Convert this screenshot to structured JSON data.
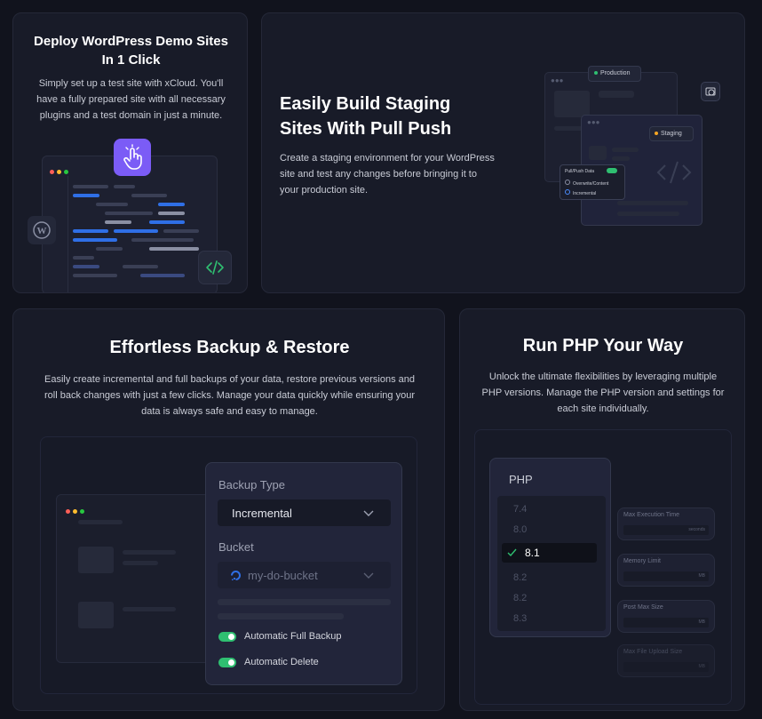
{
  "deploy": {
    "title_line1": "Deploy WordPress Demo Sites",
    "title_line2": "In 1 Click",
    "desc_line1": "Simply set up a test site with xCloud. You'll",
    "desc_line2": "have a fully prepared site with all necessary",
    "desc_line3": "plugins and a test domain in just a minute."
  },
  "staging": {
    "title_line1": "Easily Build Staging",
    "title_line2": "Sites With Pull Push",
    "desc_line1": "Create a staging environment for your WordPress",
    "desc_line2": "site and test any changes before bringing it to",
    "desc_line3": "your production site.",
    "production_label": "Production",
    "staging_label": "Staging",
    "pull_push_label": "Pull/Push Data",
    "option1": "Overwrite/Content",
    "option2": "Incremental"
  },
  "backup": {
    "title": "Effortless Backup & Restore",
    "desc_line1": "Easily create incremental and full backups of your data, restore previous versions and",
    "desc_line2": "roll back changes with just a few clicks. Manage your data quickly while ensuring your",
    "desc_line3": "data is always safe and easy to manage.",
    "backup_type_label": "Backup Type",
    "backup_type_value": "Incremental",
    "bucket_label": "Bucket",
    "bucket_value": "my-do-bucket",
    "auto_full_backup": "Automatic Full Backup",
    "auto_delete": "Automatic Delete"
  },
  "php": {
    "title": "Run PHP Your Way",
    "desc_line1": "Unlock the ultimate flexibilities by leveraging multiple",
    "desc_line2": "PHP versions. Manage the PHP version and settings for",
    "desc_line3": "each site individually.",
    "panel_title": "PHP",
    "versions": [
      "7.4",
      "8.0",
      "8.1",
      "8.2",
      "8.2",
      "8.3"
    ],
    "selected_index": 2,
    "settings": [
      "Max Execution Time",
      "Memory Limit",
      "Post Max Size",
      "Max File Upload Size"
    ],
    "setting_units": [
      "seconds",
      "MB",
      "MB",
      "MB"
    ]
  },
  "colors": {
    "accent_purple": "#7b5cf6",
    "toggle_green": "#2fbf71",
    "code_blue": "#2f6fe6"
  }
}
